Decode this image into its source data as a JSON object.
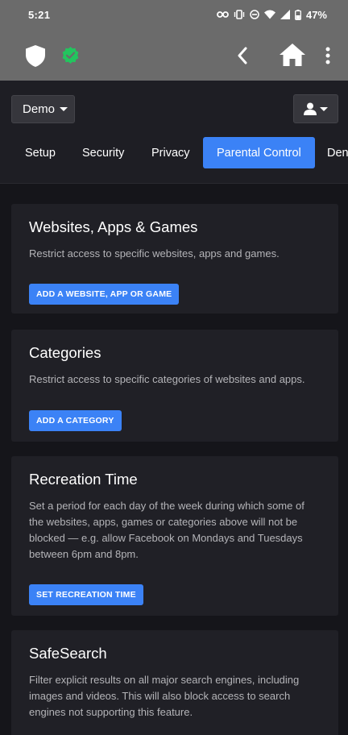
{
  "status_bar": {
    "time": "5:21",
    "battery": "47%",
    "icons": [
      "vpn-key-icon",
      "vibrate-icon",
      "dnd-icon",
      "wifi-icon",
      "signal-icon",
      "battery-icon"
    ]
  },
  "app_bar": {
    "icons": [
      "shield-icon",
      "verified-icon",
      "back-icon",
      "home-icon",
      "more-icon"
    ]
  },
  "header": {
    "profile_name": "Demo"
  },
  "tabs": [
    {
      "label": "Setup"
    },
    {
      "label": "Security"
    },
    {
      "label": "Privacy"
    },
    {
      "label": "Parental Control",
      "active": true
    },
    {
      "label": "Den"
    }
  ],
  "cards": [
    {
      "title": "Websites, Apps & Games",
      "description": "Restrict access to specific websites, apps and games.",
      "button": "ADD A WEBSITE, APP OR GAME"
    },
    {
      "title": "Categories",
      "description": "Restrict access to specific categories of websites and apps.",
      "button": "ADD A CATEGORY"
    },
    {
      "title": "Recreation Time",
      "description": "Set a period for each day of the week during which some of the websites, apps, games or categories above will not be blocked — e.g. allow Facebook on Mondays and Tuesdays between 6pm and 8pm.",
      "button": "SET RECREATION TIME"
    },
    {
      "title": "SafeSearch",
      "description": "Filter explicit results on all major search engines, including images and videos. This will also block access to search engines not supporting this feature."
    }
  ],
  "colors": {
    "accent": "#3b82f6",
    "verified": "#22c55e",
    "bar": "#6b6b6b",
    "card": "#202026",
    "background": "#15151a"
  }
}
